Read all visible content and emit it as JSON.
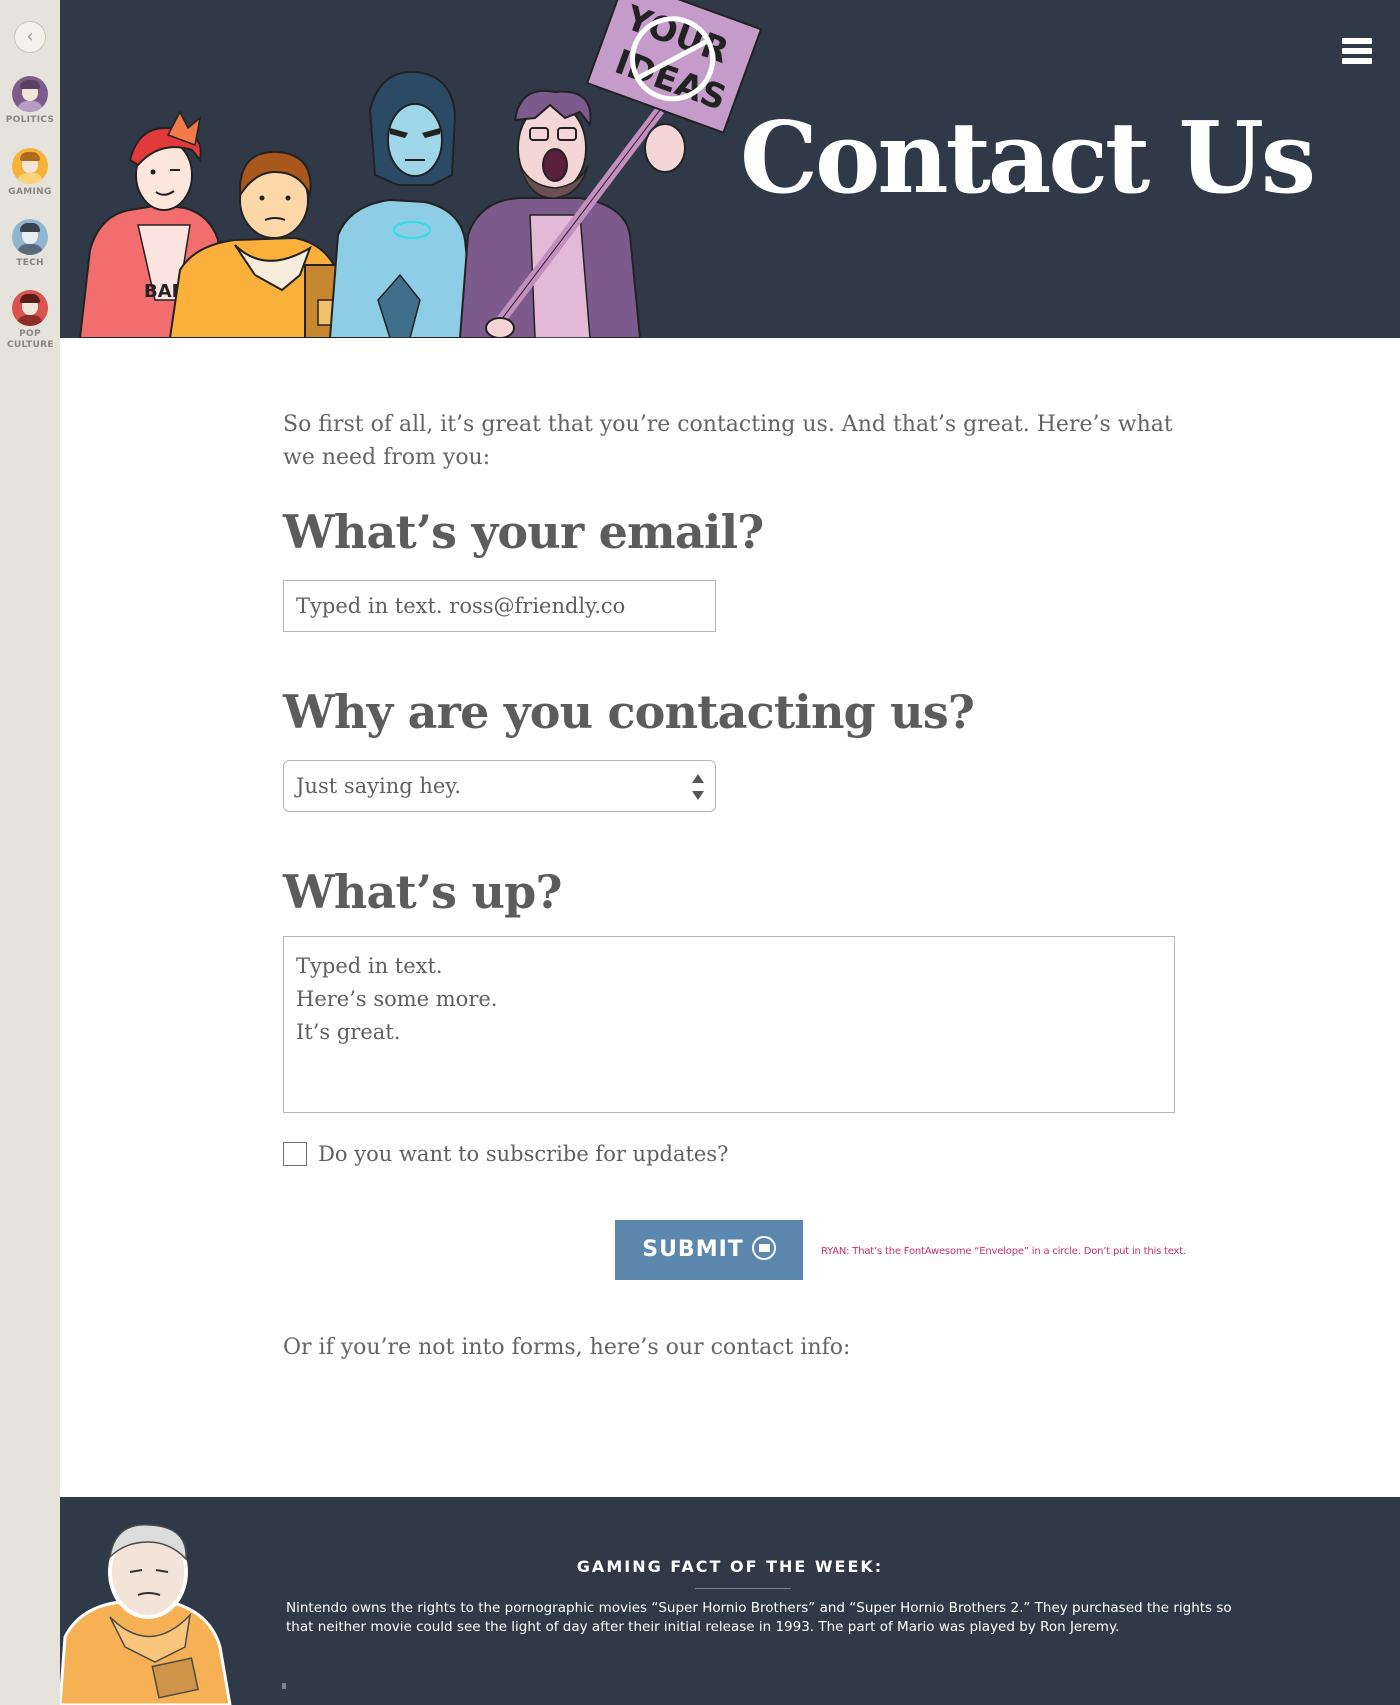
{
  "rail": {
    "back_icon": "chevron-left-icon",
    "categories": [
      {
        "label": "POLITICS",
        "color": "#7d5c8c"
      },
      {
        "label": "GAMING",
        "color": "#f4b23a"
      },
      {
        "label": "TECH",
        "color": "#8fb5cf"
      },
      {
        "label": "POP CULTURE",
        "color": "#d9534f"
      }
    ]
  },
  "header": {
    "title": "Contact Us",
    "sign_text": "YOUR IDEAS",
    "shirt_text": "BAND",
    "menu_icon": "hamburger-menu-icon",
    "background": "#303948"
  },
  "form": {
    "intro": "So first of all, it’s great that you’re contacting us. And that’s great. Here’s what we need from you:",
    "email_question": "What’s your email?",
    "email_value": "Typed in text. ross@friendly.co",
    "reason_question": "Why are you contacting us?",
    "reason_selected": "Just saying hey.",
    "message_question": "What’s up?",
    "message_lines": [
      "Typed in text.",
      "Here’s some more.",
      "It’s great."
    ],
    "subscribe_label": "Do you want to subscribe for updates?",
    "submit_label": "SUBMIT",
    "submit_icon": "envelope-circle-icon",
    "submit_color": "#5c87ae",
    "designer_note": "RYAN: That’s the FontAwesome “Envelope” in a circle.  Don’t put in this text.",
    "outro": "Or if you’re not into forms, here’s our contact info:"
  },
  "footer": {
    "fact_title": "GAMING FACT OF THE WEEK:",
    "fact_text": "Nintendo owns the rights to the pornographic movies “Super Hornio Brothers” and “Super Hornio Brothers 2.” They purchased the rights so that neither movie could see the light of day after their initial release in 1993. The part of Mario was played by Ron Jeremy."
  }
}
